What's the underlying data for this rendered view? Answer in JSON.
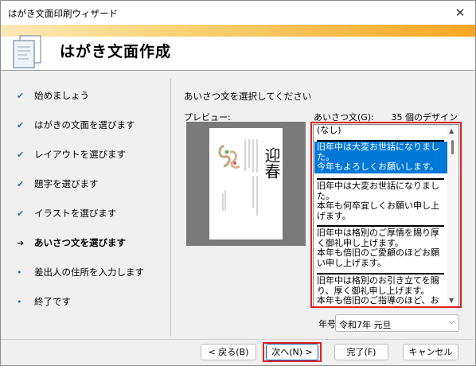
{
  "window": {
    "title": "はがき文面印刷ウィザード",
    "close_glyph": "✕"
  },
  "header": {
    "title": "はがき文面作成",
    "icon": "postcard-document-icon",
    "stripe_color": "#f6a623"
  },
  "steps": [
    {
      "label": "始めましょう",
      "state": "done",
      "marker": "✔"
    },
    {
      "label": "はがきの文面を選びます",
      "state": "done",
      "marker": "✔"
    },
    {
      "label": "レイアウトを選びます",
      "state": "done",
      "marker": "✔"
    },
    {
      "label": "題字を選びます",
      "state": "done",
      "marker": "✔"
    },
    {
      "label": "イラストを選びます",
      "state": "done",
      "marker": "✔"
    },
    {
      "label": "あいさつ文を選びます",
      "state": "current",
      "marker": "➔"
    },
    {
      "label": "差出人の住所を入力します",
      "state": "todo",
      "marker": "•"
    },
    {
      "label": "終了です",
      "state": "todo",
      "marker": "•"
    }
  ],
  "main": {
    "instruction": "あいさつ文を選択してください",
    "preview_label": "プレビュー:",
    "greeting_label": "あいさつ文(G):",
    "design_count": "35 個のデザイン",
    "preview_title": "迎春",
    "options": [
      {
        "lines": [
          "(なし)"
        ],
        "selected": false
      },
      {
        "lines": [
          "旧年中は大変お世話になりまし",
          "た。",
          "今年もよろしくお願いします。"
        ],
        "selected": true
      },
      {
        "lines": [
          "旧年中は大変お世話になりまし",
          "た。",
          "本年も何卒宜しくお願い申し上",
          "げます。"
        ],
        "selected": false
      },
      {
        "lines": [
          "旧年中は格別のご厚情を賜り厚",
          "く御礼申し上げます。",
          "本年も倍旧のご愛顧のほどお願",
          "い申し上げます。"
        ],
        "selected": false
      },
      {
        "lines": [
          "旧年中は格別のお引き立てを賜",
          "り、厚く御礼申し上げます。",
          "本年も倍旧のご指導のほど、お"
        ],
        "selected": false
      }
    ],
    "era_label": "年号(E):",
    "era_value": "令和7年 元旦"
  },
  "buttons": {
    "back": "< 戻る(B)",
    "next": "次へ(N) >",
    "finish": "完了(F)",
    "cancel": "キャンセル"
  },
  "highlight_color": "#e0201c",
  "selection_color": "#0078d7"
}
